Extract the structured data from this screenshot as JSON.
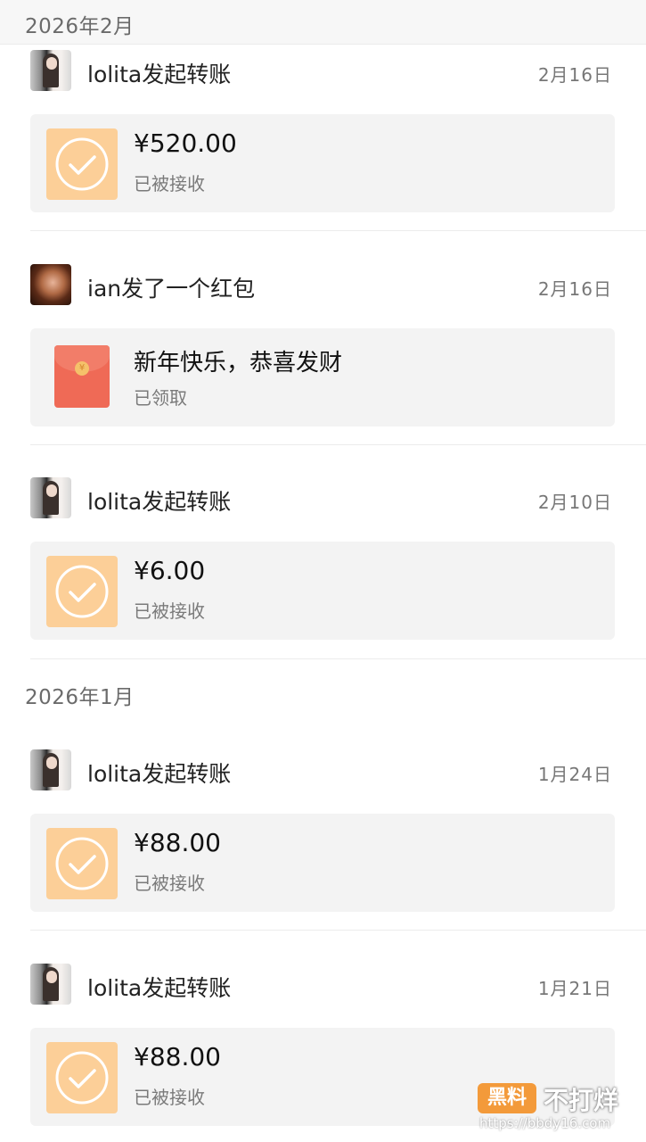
{
  "sections": [
    {
      "title": "2026年2月"
    },
    {
      "title": "2026年1月"
    }
  ],
  "records": [
    {
      "sender": "lolita发起转账",
      "date": "2月16日",
      "amount": "¥520.00",
      "status": "已被接收"
    },
    {
      "sender": "ian发了一个红包",
      "date": "2月16日",
      "greeting": "新年快乐，恭喜发财",
      "status": "已领取"
    },
    {
      "sender": "lolita发起转账",
      "date": "2月10日",
      "amount": "¥6.00",
      "status": "已被接收"
    },
    {
      "sender": "lolita发起转账",
      "date": "1月24日",
      "amount": "¥88.00",
      "status": "已被接收"
    },
    {
      "sender": "lolita发起转账",
      "date": "1月21日",
      "amount": "¥88.00",
      "status": "已被接收"
    }
  ],
  "icons": {
    "transfer": "check-circle-icon",
    "red_packet": "red-packet-icon"
  },
  "colors": {
    "transfer_icon_bg": "#fccf98",
    "red_packet": "#ef6a56",
    "card_bg": "#f3f3f3"
  },
  "watermark": {
    "logo": "黑料",
    "name": "不打烊",
    "url": "https://bbdy16.com"
  }
}
